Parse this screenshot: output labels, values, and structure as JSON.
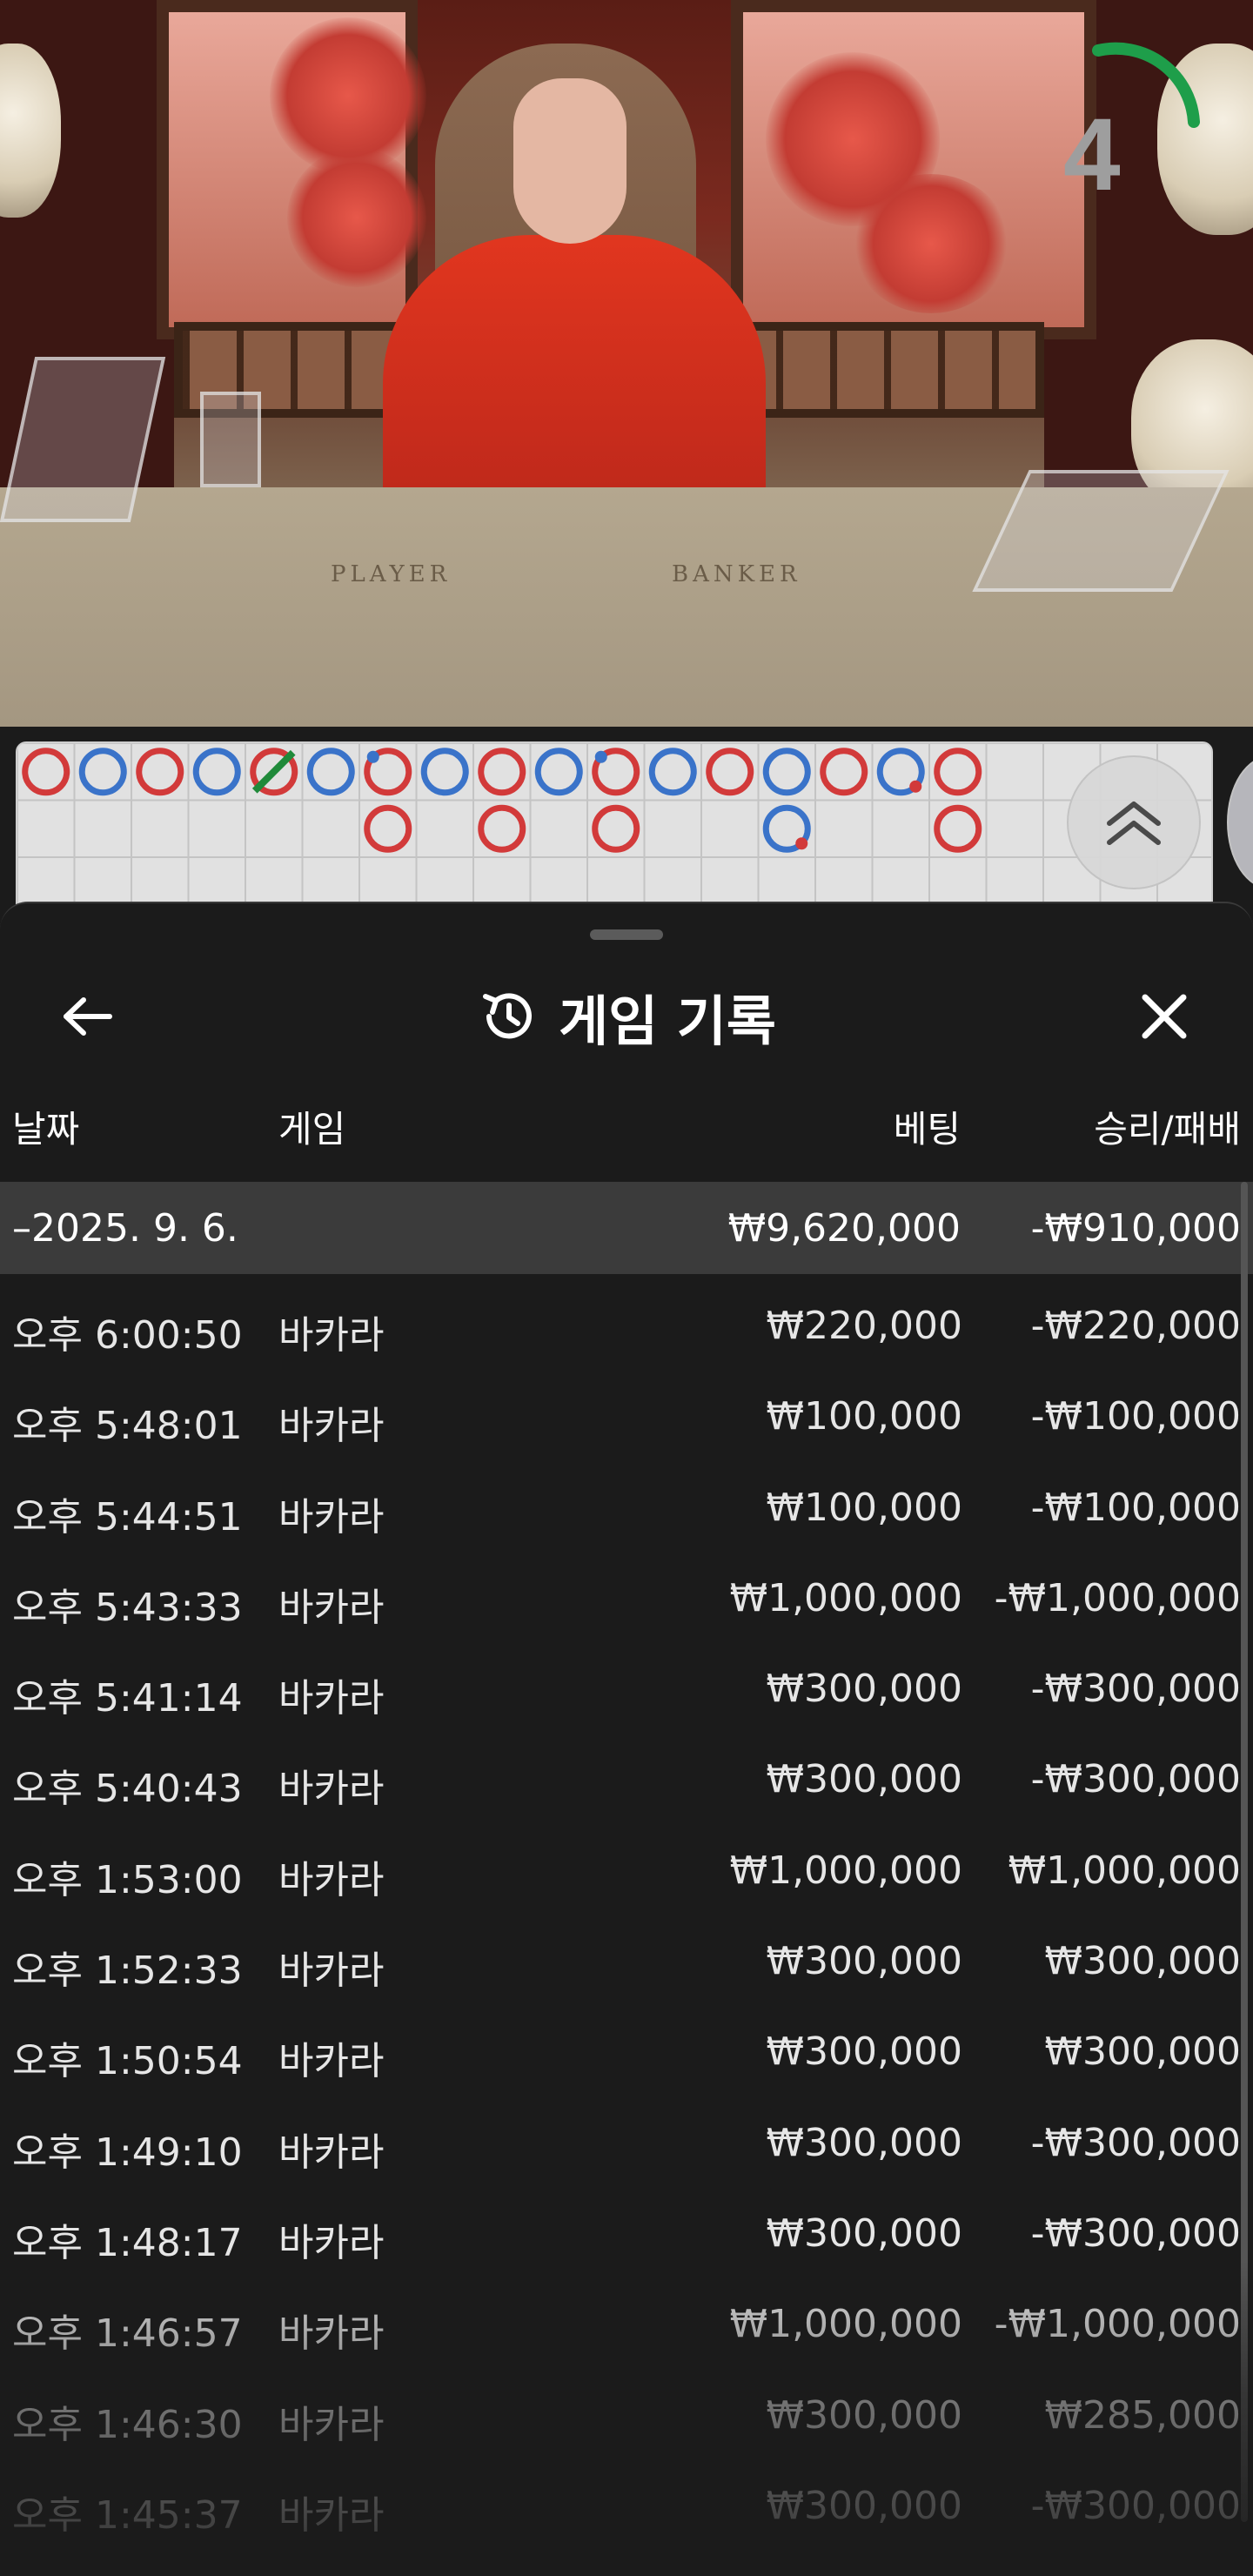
{
  "video": {
    "countdown": "4",
    "table_labels": {
      "player": "PLAYER",
      "banker": "BANKER"
    },
    "countdown_arc_color": "#1e9e4a"
  },
  "roadmap": {
    "colors": {
      "player": "#3a73c9",
      "banker": "#d23a3a",
      "tie": "#1f8a3a"
    },
    "columns": [
      [
        "B"
      ],
      [
        "P"
      ],
      [
        "B"
      ],
      [
        "P"
      ],
      [
        "B-tie"
      ],
      [
        "P"
      ],
      [
        "B-pp",
        "B"
      ],
      [
        "P"
      ],
      [
        "B",
        "B"
      ],
      [
        "P"
      ],
      [
        "B-pp",
        "B"
      ],
      [
        "P"
      ],
      [
        "B"
      ],
      [
        "P",
        "P-bp"
      ],
      [
        "B"
      ],
      [
        "P-bp"
      ],
      [
        "B",
        "B"
      ]
    ],
    "expand_icon": "double-chevron-up-icon"
  },
  "history": {
    "title": "게임 기록",
    "title_icon": "history-icon",
    "back_icon": "arrow-left-icon",
    "close_icon": "close-icon",
    "columns": {
      "date": "날짜",
      "game": "게임",
      "bet": "베팅",
      "result": "승리/패배"
    },
    "group": {
      "date": "–2025. 9. 6.",
      "bet_total": "₩9,620,000",
      "result_total": "-₩910,000"
    },
    "rows": [
      {
        "time": "오후 6:00:50",
        "game": "바카라",
        "bet": "₩220,000",
        "result": "-₩220,000"
      },
      {
        "time": "오후 5:48:01",
        "game": "바카라",
        "bet": "₩100,000",
        "result": "-₩100,000"
      },
      {
        "time": "오후 5:44:51",
        "game": "바카라",
        "bet": "₩100,000",
        "result": "-₩100,000"
      },
      {
        "time": "오후 5:43:33",
        "game": "바카라",
        "bet": "₩1,000,000",
        "result": "-₩1,000,000"
      },
      {
        "time": "오후 5:41:14",
        "game": "바카라",
        "bet": "₩300,000",
        "result": "-₩300,000"
      },
      {
        "time": "오후 5:40:43",
        "game": "바카라",
        "bet": "₩300,000",
        "result": "-₩300,000"
      },
      {
        "time": "오후 1:53:00",
        "game": "바카라",
        "bet": "₩1,000,000",
        "result": "₩1,000,000"
      },
      {
        "time": "오후 1:52:33",
        "game": "바카라",
        "bet": "₩300,000",
        "result": "₩300,000"
      },
      {
        "time": "오후 1:50:54",
        "game": "바카라",
        "bet": "₩300,000",
        "result": "₩300,000"
      },
      {
        "time": "오후 1:49:10",
        "game": "바카라",
        "bet": "₩300,000",
        "result": "-₩300,000"
      },
      {
        "time": "오후 1:48:17",
        "game": "바카라",
        "bet": "₩300,000",
        "result": "-₩300,000"
      },
      {
        "time": "오후 1:46:57",
        "game": "바카라",
        "bet": "₩1,000,000",
        "result": "-₩1,000,000"
      },
      {
        "time": "오후 1:46:30",
        "game": "바카라",
        "bet": "₩300,000",
        "result": "₩285,000"
      },
      {
        "time": "오후 1:45:37",
        "game": "바카라",
        "bet": "₩300,000",
        "result": "-₩300,000"
      }
    ]
  }
}
